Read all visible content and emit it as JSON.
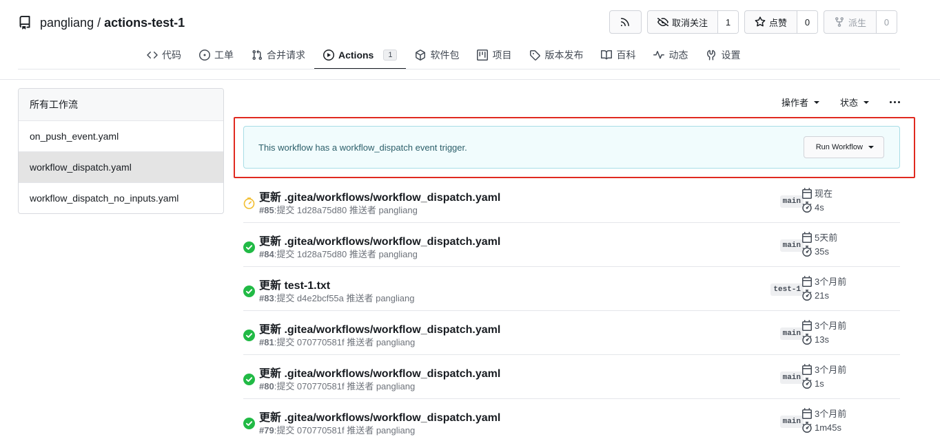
{
  "repo": {
    "owner": "pangliang",
    "separator": "/",
    "name": "actions-test-1",
    "buttons": {
      "unwatch_label": "取消关注",
      "unwatch_count": "1",
      "star_label": "点赞",
      "star_count": "0",
      "fork_label": "派生",
      "fork_count": "0"
    }
  },
  "tabs": [
    {
      "label": "代码",
      "icon": "code-icon"
    },
    {
      "label": "工单",
      "icon": "issue-icon"
    },
    {
      "label": "合并请求",
      "icon": "pull-request-icon"
    },
    {
      "label": "Actions",
      "icon": "play-icon",
      "count": "1",
      "active": true
    },
    {
      "label": "软件包",
      "icon": "package-icon"
    },
    {
      "label": "项目",
      "icon": "project-icon"
    },
    {
      "label": "版本发布",
      "icon": "tag-icon"
    },
    {
      "label": "百科",
      "icon": "book-icon"
    },
    {
      "label": "动态",
      "icon": "pulse-icon"
    },
    {
      "label": "设置",
      "icon": "tools-icon"
    }
  ],
  "sidebar": {
    "items": [
      {
        "label": "所有工作流"
      },
      {
        "label": "on_push_event.yaml"
      },
      {
        "label": "workflow_dispatch.yaml",
        "selected": true
      },
      {
        "label": "workflow_dispatch_no_inputs.yaml"
      }
    ]
  },
  "filters": {
    "actor": "操作者",
    "status": "状态"
  },
  "dispatch": {
    "message": "This workflow has a workflow_dispatch event trigger.",
    "run_button": "Run Workflow"
  },
  "runs": [
    {
      "status": "running",
      "title": "更新 .gitea/workflows/workflow_dispatch.yaml",
      "number": "#85",
      "meta": ":提交 1d28a75d80 推送者 pangliang",
      "branch": "main",
      "when": "现在",
      "duration": "4s"
    },
    {
      "status": "success",
      "title": "更新 .gitea/workflows/workflow_dispatch.yaml",
      "number": "#84",
      "meta": ":提交 1d28a75d80 推送者 pangliang",
      "branch": "main",
      "when": "5天前",
      "duration": "35s"
    },
    {
      "status": "success",
      "title": "更新 test-1.txt",
      "number": "#83",
      "meta": ":提交 d4e2bcf55a 推送者 pangliang",
      "branch": "test-1",
      "when": "3个月前",
      "duration": "21s"
    },
    {
      "status": "success",
      "title": "更新 .gitea/workflows/workflow_dispatch.yaml",
      "number": "#81",
      "meta": ":提交 070770581f 推送者 pangliang",
      "branch": "main",
      "when": "3个月前",
      "duration": "13s"
    },
    {
      "status": "success",
      "title": "更新 .gitea/workflows/workflow_dispatch.yaml",
      "number": "#80",
      "meta": ":提交 070770581f 推送者 pangliang",
      "branch": "main",
      "when": "3个月前",
      "duration": "1s"
    },
    {
      "status": "success",
      "title": "更新 .gitea/workflows/workflow_dispatch.yaml",
      "number": "#79",
      "meta": ":提交 070770581f 推送者 pangliang",
      "branch": "main",
      "when": "3个月前",
      "duration": "1m45s"
    }
  ],
  "colors": {
    "success": "#21ba45",
    "running": "#f2c037",
    "highlight": "#e0291f",
    "info_bg": "#f1fcfd"
  }
}
